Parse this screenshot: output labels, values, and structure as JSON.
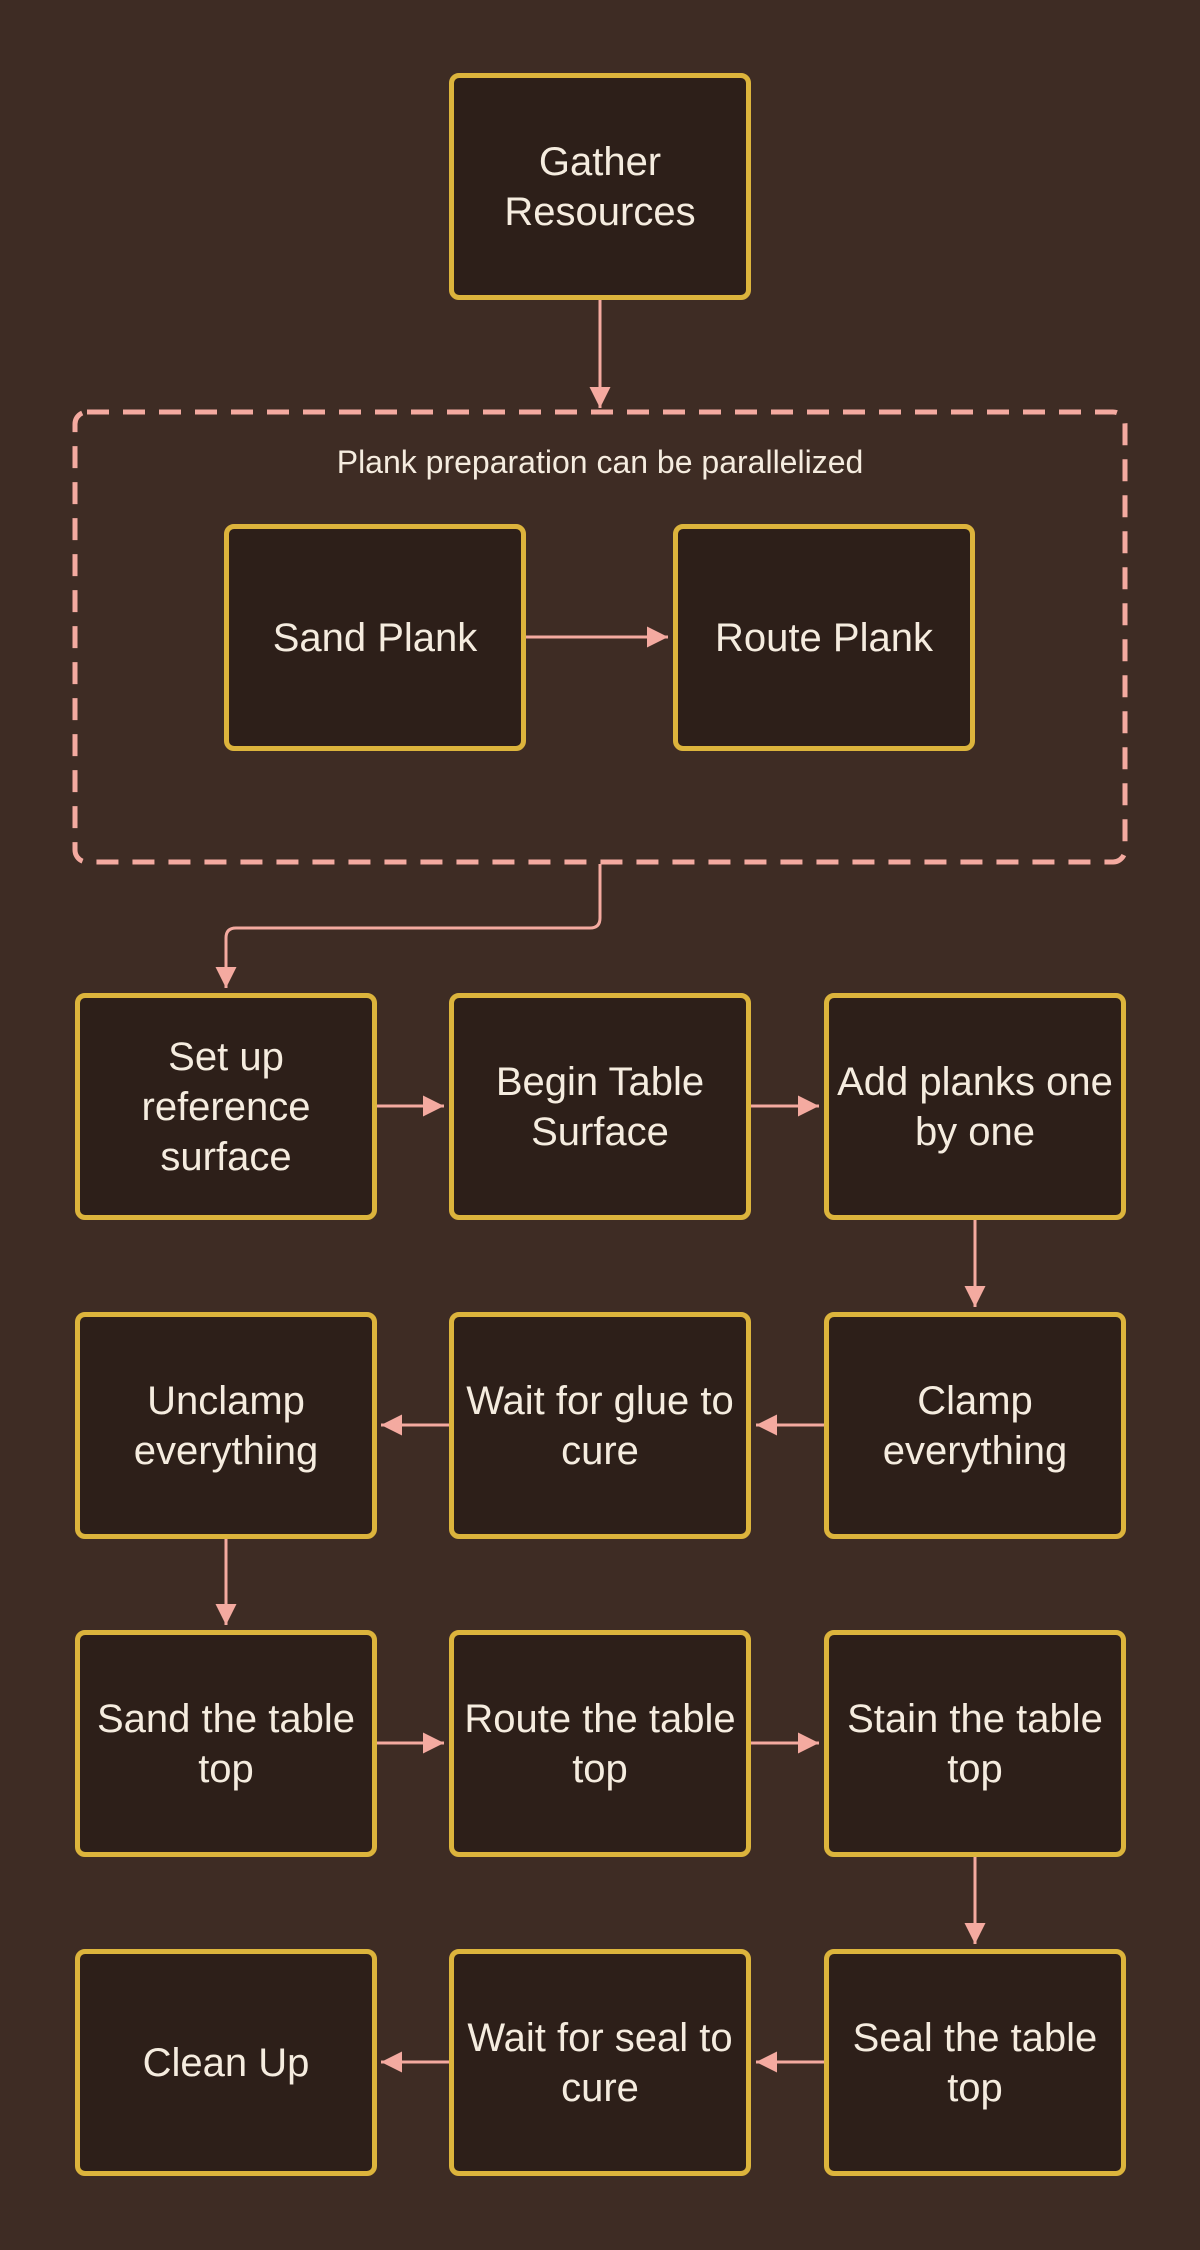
{
  "colors": {
    "background": "#3e2c24",
    "node_fill": "#2d1f19",
    "node_border": "#dcb43c",
    "edge": "#f4aaa0",
    "text": "#f5ecdf"
  },
  "group": {
    "label": "Plank preparation can be parallelized",
    "nodes": [
      "Sand Plank",
      "Route Plank"
    ]
  },
  "nodes": {
    "gather": "Gather Resources",
    "sand_plank": "Sand Plank",
    "route_plank": "Route Plank",
    "setup_ref": "Set up reference surface",
    "begin_table": "Begin Table Surface",
    "add_planks": "Add planks one by one",
    "clamp": "Clamp everything",
    "wait_glue": "Wait for glue to cure",
    "unclamp": "Unclamp everything",
    "sand_top": "Sand the table top",
    "route_top": "Route the table top",
    "stain_top": "Stain the table top",
    "seal_top": "Seal the table top",
    "wait_seal": "Wait for seal to cure",
    "clean_up": "Clean Up"
  },
  "edges": [
    [
      "gather",
      "group"
    ],
    [
      "sand_plank",
      "route_plank"
    ],
    [
      "group",
      "setup_ref"
    ],
    [
      "setup_ref",
      "begin_table"
    ],
    [
      "begin_table",
      "add_planks"
    ],
    [
      "add_planks",
      "clamp"
    ],
    [
      "clamp",
      "wait_glue"
    ],
    [
      "wait_glue",
      "unclamp"
    ],
    [
      "unclamp",
      "sand_top"
    ],
    [
      "sand_top",
      "route_top"
    ],
    [
      "route_top",
      "stain_top"
    ],
    [
      "stain_top",
      "seal_top"
    ],
    [
      "seal_top",
      "wait_seal"
    ],
    [
      "wait_seal",
      "clean_up"
    ]
  ]
}
